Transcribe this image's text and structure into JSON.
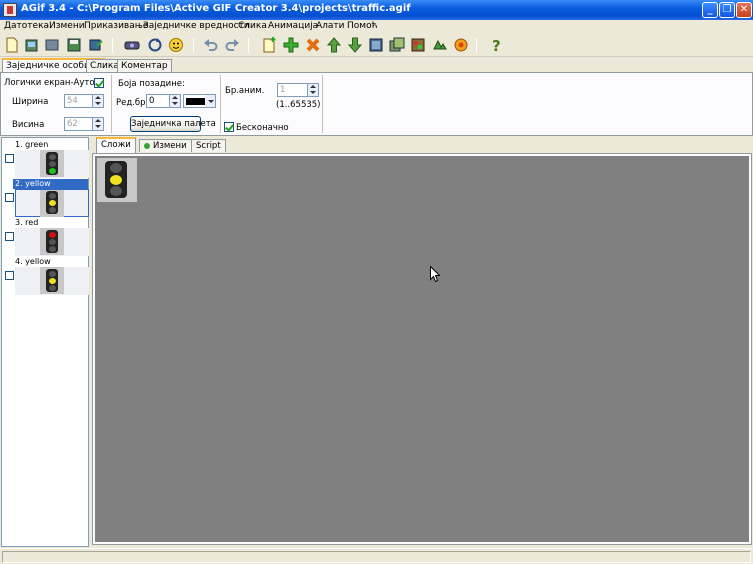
{
  "window": {
    "title": "AGif 3.4 - C:\\Program Files\\Active GIF Creator 3.4\\projects\\traffic.agif",
    "minimize_symbol": "_",
    "maximize_symbol": "❐",
    "close_symbol": "✕"
  },
  "menu": [
    "Датотека",
    "Измени",
    "Приказивање",
    "Заједничке вредности",
    "Слика",
    "Анимација",
    "Алати",
    "Помоћ"
  ],
  "toolbar_icons": [
    "new-icon",
    "open-icon",
    "import-icon",
    "save-icon",
    "save-as-icon",
    "preview-icon",
    "refresh-icon",
    "smiley-icon",
    "undo-icon",
    "redo-icon",
    "add-frame-icon",
    "insert-frame-icon",
    "delete-frame-icon",
    "move-up-icon",
    "move-down-icon",
    "frame-properties-icon",
    "duplicate-frame-icon",
    "palette-icon",
    "effects-icon",
    "optimize-icon",
    "help-icon"
  ],
  "tabs": [
    "Заједничке особине",
    "Слика",
    "Коментар"
  ],
  "common": {
    "logical_screen_auto": "Логички екран-Аутом.",
    "width_label": "Ширина",
    "width_value": "54",
    "height_label": "Висина",
    "height_value": "62",
    "bg_color_label": "Боја позадине:",
    "index_label": "Ред.бр.",
    "index_value": "0",
    "bg_color": "#000000",
    "palette_button": "Заједничка палета",
    "anim_count_label": "Бр.аним.",
    "anim_count_value": "1",
    "anim_range": "(1..65535)",
    "infinite_label": "Бесконачно"
  },
  "frames": [
    {
      "title": "1. green",
      "lamp": "green"
    },
    {
      "title": "2. yellow",
      "lamp": "yellow",
      "selected": true
    },
    {
      "title": "3. red",
      "lamp": "red"
    },
    {
      "title": "4. yellow",
      "lamp": "yellow"
    }
  ],
  "editor_tabs": [
    "Сложи",
    "Измени",
    "Script"
  ],
  "colors": {
    "canvas": "#808080",
    "selection": "#316ac5",
    "lamp_red": "#d01010",
    "lamp_yellow": "#f0e020",
    "lamp_green": "#20c020",
    "lamp_off": "#555555"
  }
}
